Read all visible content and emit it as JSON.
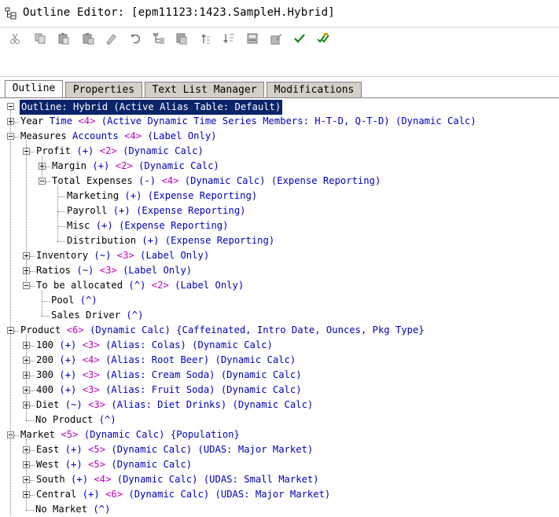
{
  "window": {
    "title": "Outline Editor: [epm11123:1423.SampleH.Hybrid]"
  },
  "toolbar": {
    "buttons": [
      {
        "icon": "cut-icon"
      },
      {
        "icon": "copy-icon"
      },
      {
        "icon": "paste-icon"
      },
      {
        "icon": "paste-special-icon"
      },
      {
        "icon": "rename-icon"
      },
      {
        "icon": "undo-icon"
      },
      {
        "icon": "add-child-icon"
      },
      {
        "icon": "add-sibling-icon"
      },
      {
        "icon": "move-up-icon"
      },
      {
        "icon": "sort-icon"
      },
      {
        "icon": "calculator-icon"
      },
      {
        "icon": "edit-formula-icon"
      },
      {
        "icon": "verify-icon"
      },
      {
        "icon": "verify-all-icon"
      }
    ]
  },
  "tabs": [
    {
      "label": "Outline",
      "active": true
    },
    {
      "label": "Properties",
      "active": false
    },
    {
      "label": "Text List Manager",
      "active": false
    },
    {
      "label": "Modifications",
      "active": false
    }
  ],
  "tree": {
    "root": "Outline: Hybrid (Active Alias Table: Default)",
    "rows": [
      {
        "name": "Year",
        "parts": [
          [
            "Time",
            "blue"
          ],
          [
            "<4>",
            "mag"
          ],
          [
            "(Active Dynamic Time Series Members: H-T-D, Q-T-D)",
            "blue"
          ],
          [
            "(Dynamic Calc)",
            "blue"
          ]
        ]
      },
      {
        "name": "Measures",
        "parts": [
          [
            "Accounts",
            "blue"
          ],
          [
            "<4>",
            "mag"
          ],
          [
            "(Label Only)",
            "blue"
          ]
        ]
      },
      {
        "name": "Profit",
        "parts": [
          [
            "(+)",
            "blue"
          ],
          [
            "<2>",
            "mag"
          ],
          [
            "(Dynamic Calc)",
            "blue"
          ]
        ]
      },
      {
        "name": "Margin",
        "parts": [
          [
            "(+)",
            "blue"
          ],
          [
            "<2>",
            "mag"
          ],
          [
            "(Dynamic Calc)",
            "blue"
          ]
        ]
      },
      {
        "name": "Total Expenses",
        "parts": [
          [
            "(-)",
            "blue"
          ],
          [
            "<4>",
            "mag"
          ],
          [
            "(Dynamic Calc)",
            "blue"
          ],
          [
            "(Expense Reporting)",
            "blue"
          ]
        ]
      },
      {
        "name": "Marketing",
        "parts": [
          [
            "(+)",
            "blue"
          ],
          [
            "(Expense Reporting)",
            "blue"
          ]
        ]
      },
      {
        "name": "Payroll",
        "parts": [
          [
            "(+)",
            "blue"
          ],
          [
            "(Expense Reporting)",
            "blue"
          ]
        ]
      },
      {
        "name": "Misc",
        "parts": [
          [
            "(+)",
            "blue"
          ],
          [
            "(Expense Reporting)",
            "blue"
          ]
        ]
      },
      {
        "name": "Distribution",
        "parts": [
          [
            "(+)",
            "blue"
          ],
          [
            "(Expense Reporting)",
            "blue"
          ]
        ]
      },
      {
        "name": "Inventory",
        "parts": [
          [
            "(~)",
            "blue"
          ],
          [
            "<3>",
            "mag"
          ],
          [
            "(Label Only)",
            "blue"
          ]
        ]
      },
      {
        "name": "Ratios",
        "parts": [
          [
            "(~)",
            "blue"
          ],
          [
            "<3>",
            "mag"
          ],
          [
            "(Label Only)",
            "blue"
          ]
        ]
      },
      {
        "name": "To be allocated",
        "parts": [
          [
            "(^)",
            "blue"
          ],
          [
            "<2>",
            "mag"
          ],
          [
            "(Label Only)",
            "blue"
          ]
        ]
      },
      {
        "name": "Pool",
        "parts": [
          [
            "(^)",
            "blue"
          ]
        ]
      },
      {
        "name": "Sales Driver",
        "parts": [
          [
            "(^)",
            "blue"
          ]
        ]
      },
      {
        "name": "Product",
        "parts": [
          [
            "<6>",
            "mag"
          ],
          [
            "(Dynamic Calc)",
            "blue"
          ],
          [
            "{Caffeinated, Intro Date, Ounces, Pkg Type}",
            "blue"
          ]
        ]
      },
      {
        "name": "100",
        "parts": [
          [
            "(+)",
            "blue"
          ],
          [
            "<3>",
            "mag"
          ],
          [
            "(Alias: Colas)",
            "blue"
          ],
          [
            "(Dynamic Calc)",
            "blue"
          ]
        ]
      },
      {
        "name": "200",
        "parts": [
          [
            "(+)",
            "blue"
          ],
          [
            "<4>",
            "mag"
          ],
          [
            "(Alias: Root Beer)",
            "blue"
          ],
          [
            "(Dynamic Calc)",
            "blue"
          ]
        ]
      },
      {
        "name": "300",
        "parts": [
          [
            "(+)",
            "blue"
          ],
          [
            "<3>",
            "mag"
          ],
          [
            "(Alias: Cream Soda)",
            "blue"
          ],
          [
            "(Dynamic Calc)",
            "blue"
          ]
        ]
      },
      {
        "name": "400",
        "parts": [
          [
            "(+)",
            "blue"
          ],
          [
            "<3>",
            "mag"
          ],
          [
            "(Alias: Fruit Soda)",
            "blue"
          ],
          [
            "(Dynamic Calc)",
            "blue"
          ]
        ]
      },
      {
        "name": "Diet",
        "parts": [
          [
            "(~)",
            "blue"
          ],
          [
            "<3>",
            "mag"
          ],
          [
            "(Alias: Diet Drinks)",
            "blue"
          ],
          [
            "(Dynamic Calc)",
            "blue"
          ]
        ]
      },
      {
        "name": "No Product",
        "parts": [
          [
            "(^)",
            "blue"
          ]
        ]
      },
      {
        "name": "Market",
        "parts": [
          [
            "<5>",
            "mag"
          ],
          [
            "(Dynamic Calc)",
            "blue"
          ],
          [
            "{Population}",
            "blue"
          ]
        ]
      },
      {
        "name": "East",
        "parts": [
          [
            "(+)",
            "blue"
          ],
          [
            "<5>",
            "mag"
          ],
          [
            "(Dynamic Calc)",
            "blue"
          ],
          [
            "(UDAS: Major Market)",
            "blue"
          ]
        ]
      },
      {
        "name": "West",
        "parts": [
          [
            "(+)",
            "blue"
          ],
          [
            "<5>",
            "mag"
          ],
          [
            "(Dynamic Calc)",
            "blue"
          ]
        ]
      },
      {
        "name": "South",
        "parts": [
          [
            "(+)",
            "blue"
          ],
          [
            "<4>",
            "mag"
          ],
          [
            "(Dynamic Calc)",
            "blue"
          ],
          [
            "(UDAS: Small Market)",
            "blue"
          ]
        ]
      },
      {
        "name": "Central",
        "parts": [
          [
            "(+)",
            "blue"
          ],
          [
            "<6>",
            "mag"
          ],
          [
            "(Dynamic Calc)",
            "blue"
          ],
          [
            "(UDAS: Major Market)",
            "blue"
          ]
        ]
      },
      {
        "name": "No Market",
        "parts": [
          [
            "(^)",
            "blue"
          ]
        ]
      }
    ]
  },
  "colors": {
    "selection": "#0a246a",
    "member_info": "#0000c0",
    "child_count": "#c000c0",
    "tab_face": "#d4d0c8"
  }
}
